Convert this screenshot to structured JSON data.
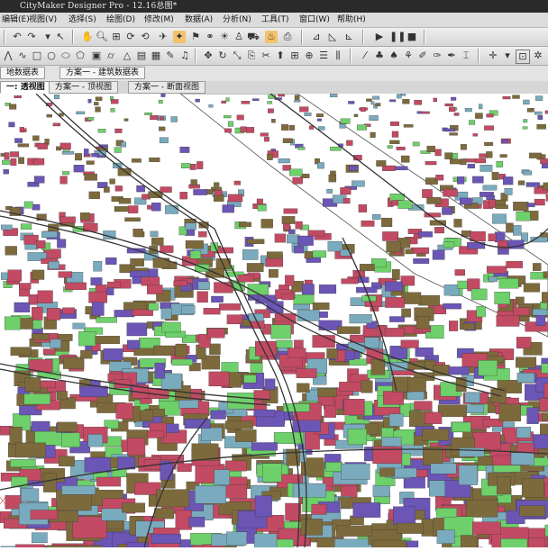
{
  "app": {
    "window_title": "CityMaker Designer Pro - 12.16总图*"
  },
  "menu": [
    {
      "label": "编辑(E)"
    },
    {
      "label": "视图(V)"
    },
    {
      "label": "选择(S)"
    },
    {
      "label": "绘图(D)"
    },
    {
      "label": "修改(M)"
    },
    {
      "label": "数据(A)"
    },
    {
      "label": "分析(N)"
    },
    {
      "label": "工具(T)"
    },
    {
      "label": "窗口(W)"
    },
    {
      "label": "帮助(H)"
    }
  ],
  "toolbar_row1": [
    "undo-icon",
    "redo-icon",
    "pointer-icon",
    "hand-icon",
    "zoom-icon",
    "zoom-box-icon",
    "refresh-icon",
    "rotate-icon",
    "walk-icon",
    "fly-icon",
    "person-icon",
    "light-icon",
    "camera-icon",
    "measure-icon",
    "slope-icon",
    "play-icon",
    "pause-icon",
    "stop-icon"
  ],
  "toolbar_row2": [
    "line-icon",
    "curve-icon",
    "rect-icon",
    "circle-icon",
    "ellipse-icon",
    "polygon-icon",
    "box-icon",
    "cylinder-icon",
    "layer-icon",
    "move-icon",
    "rotate-obj-icon",
    "scale-icon",
    "copy-icon",
    "delete-icon",
    "extrude-icon",
    "grid-icon",
    "snap-icon",
    "align-icon"
  ],
  "panels": {
    "tab_land": "地数据表",
    "tab_building": "方案一 - 建筑数据表",
    "view_tabs": [
      {
        "label": "一: 透视图",
        "active": true
      },
      {
        "label": "方案一 - 顶视图",
        "active": false
      },
      {
        "label": "方案一 - 断面视图",
        "active": false
      }
    ]
  },
  "colors": {
    "building_red": "#c24a63",
    "building_olive": "#7d6a3c",
    "building_purple": "#6b55b5",
    "building_blue": "#7aaabd",
    "building_green": "#6dd06a",
    "ground": "#ffffff"
  }
}
